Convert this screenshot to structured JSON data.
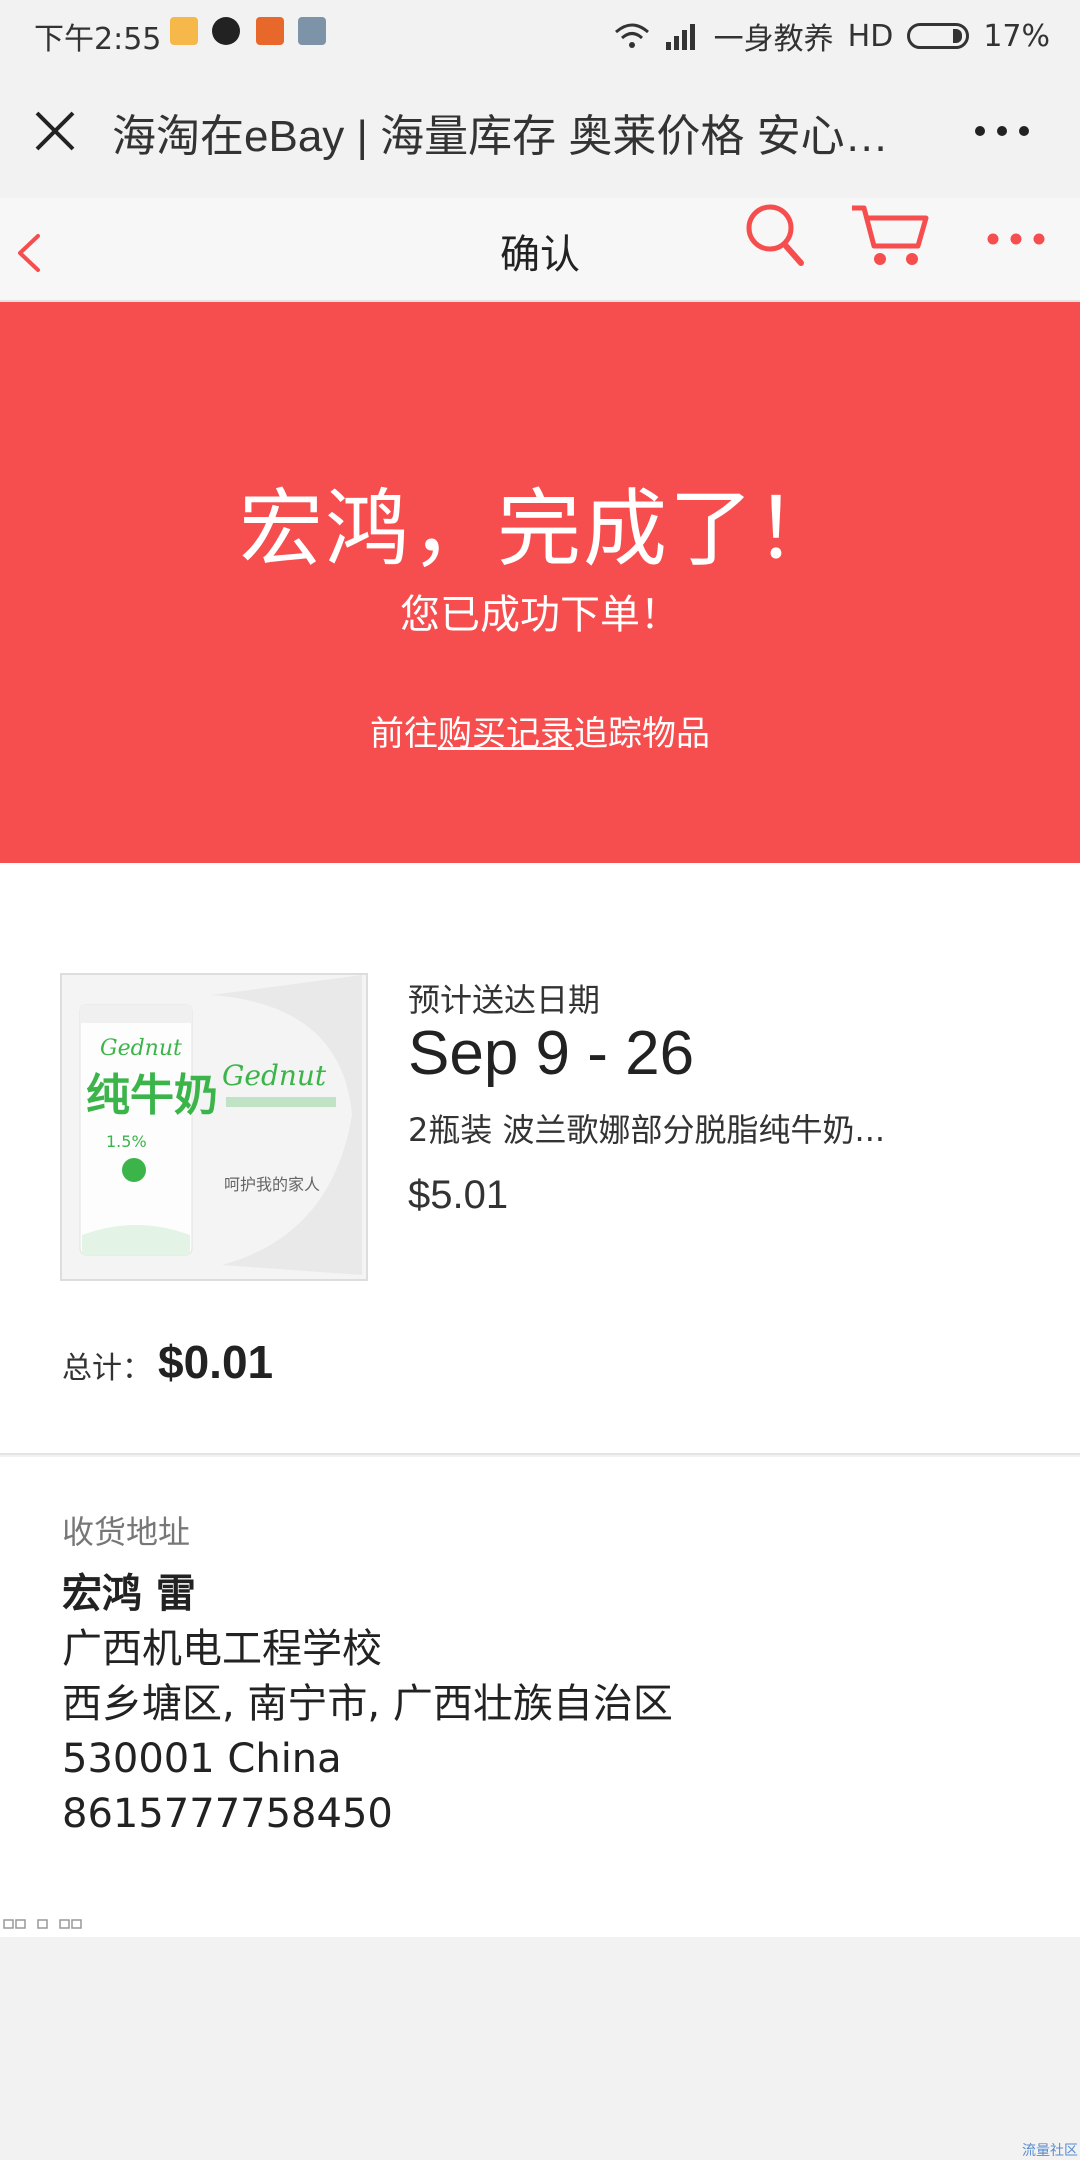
{
  "status_bar": {
    "time": "下午2:55",
    "carrier": "一身教养",
    "network": "HD",
    "battery_percent": "17%",
    "battery_level": 0.17
  },
  "webview": {
    "title": "海淘在eBay | 海量库存 奥莱价格 安心购物",
    "close_icon": "close-icon",
    "more_icon": "more-horizontal-icon"
  },
  "nav": {
    "title": "确认",
    "back_icon": "chevron-left-icon",
    "search_icon": "search-icon",
    "cart_icon": "cart-icon",
    "more_icon": "more-horizontal-icon",
    "accent_color": "#f64e4e"
  },
  "hero": {
    "title": "宏鸿，完成了！",
    "subtitle": "您已成功下单！",
    "track_prefix": "前往",
    "track_link": "购买记录",
    "track_suffix": "追踪物品",
    "background": "#f64e4e"
  },
  "order": {
    "estimated_label": "预计送达日期",
    "estimated_date": "Sep 9 - 26",
    "item_name": "2瓶装 波兰歌娜部分脱脂纯牛奶...",
    "item_price": "$5.01",
    "total_label": "总计：",
    "total_value": "$0.01",
    "product_image": {
      "brand": "Gednut",
      "main_text": "纯牛奶",
      "fat": "1.5%",
      "slogan": "呵护我的家人"
    }
  },
  "shipping": {
    "heading": "收货地址",
    "name": "宏鸿 雷",
    "line1": "广西机电工程学校",
    "line2": "西乡塘区, 南宁市, 广西壮族自治区",
    "line3": "530001 China",
    "phone": "8615777758450"
  },
  "footer": {
    "watermark": "流量社区"
  }
}
